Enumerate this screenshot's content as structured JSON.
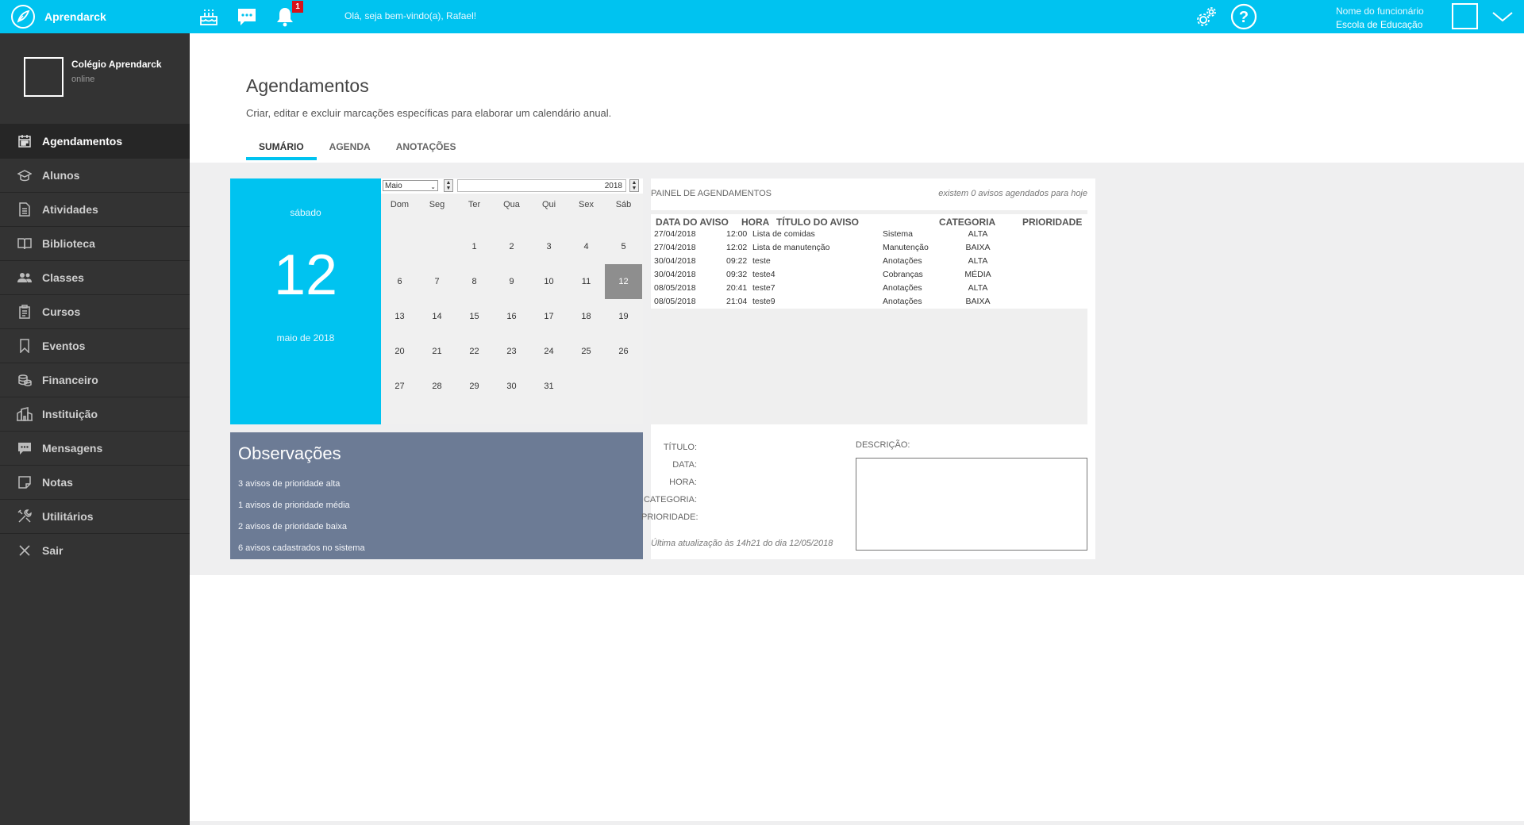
{
  "topbar": {
    "app_name": "Aprendarck",
    "notification_count": "1",
    "welcome": "Olá, seja bem-vindo(a), Rafael!",
    "user_name": "Nome do funcionário",
    "user_school": "Escola de Educação",
    "icons": [
      "logo-icon",
      "cake-icon",
      "chat-icon",
      "bell-icon",
      "gears-icon",
      "help-icon",
      "chevron-down-icon"
    ],
    "bg_color": "#00c3f0"
  },
  "sidebar": {
    "school_name": "Colégio Aprendarck",
    "status": "online",
    "items": [
      {
        "label": "Agendamentos",
        "icon": "calendar-icon"
      },
      {
        "label": "Alunos",
        "icon": "graduation-cap-icon"
      },
      {
        "label": "Atividades",
        "icon": "document-icon"
      },
      {
        "label": "Biblioteca",
        "icon": "book-icon"
      },
      {
        "label": "Classes",
        "icon": "users-icon"
      },
      {
        "label": "Cursos",
        "icon": "clipboard-icon"
      },
      {
        "label": "Eventos",
        "icon": "bookmark-icon"
      },
      {
        "label": "Financeiro",
        "icon": "coins-icon"
      },
      {
        "label": "Instituição",
        "icon": "building-icon"
      },
      {
        "label": "Mensagens",
        "icon": "message-icon"
      },
      {
        "label": "Notas",
        "icon": "note-icon"
      },
      {
        "label": "Utilitários",
        "icon": "tools-icon"
      },
      {
        "label": "Sair",
        "icon": "close-icon"
      }
    ]
  },
  "main": {
    "title": "Agendamentos",
    "description": "Criar, editar e excluir marcações específicas para elaborar um calendário anual.",
    "tabs": [
      {
        "label": "SUMÁRIO"
      },
      {
        "label": "AGENDA"
      },
      {
        "label": "ANOTAÇÕES"
      }
    ]
  },
  "date_panel": {
    "weekday": "sábado",
    "day": "12",
    "month_year": "maio de 2018"
  },
  "calendar": {
    "month": "Maio",
    "year": "2018",
    "weekdays": [
      "Dom",
      "Seg",
      "Ter",
      "Qua",
      "Qui",
      "Sex",
      "Sáb"
    ],
    "weeks": [
      [
        "",
        "",
        "1",
        "2",
        "3",
        "4",
        "5"
      ],
      [
        "6",
        "7",
        "8",
        "9",
        "10",
        "11",
        "12"
      ],
      [
        "13",
        "14",
        "15",
        "16",
        "17",
        "18",
        "19"
      ],
      [
        "20",
        "21",
        "22",
        "23",
        "24",
        "25",
        "26"
      ],
      [
        "27",
        "28",
        "29",
        "30",
        "31",
        "",
        ""
      ]
    ],
    "selected": "12"
  },
  "observations": {
    "title": "Observações",
    "lines": [
      "3 avisos de prioridade alta",
      "1 avisos de prioridade média",
      "2 avisos de prioridade baixa",
      "6 avisos cadastrados no sistema"
    ]
  },
  "schedule_panel": {
    "title": "PAINEL DE AGENDAMENTOS",
    "today_count": "existem 0 avisos agendados para hoje",
    "columns": [
      "DATA DO AVISO",
      "HORA",
      "TÍTULO DO AVISO",
      "CATEGORIA",
      "PRIORIDADE"
    ],
    "rows": [
      [
        "27/04/2018",
        "12:00",
        "Lista de comidas",
        "Sistema",
        "ALTA"
      ],
      [
        "27/04/2018",
        "12:02",
        "Lista de manutenção",
        "Manutenção",
        "BAIXA"
      ],
      [
        "30/04/2018",
        "09:22",
        "teste",
        "Anotações",
        "ALTA"
      ],
      [
        "30/04/2018",
        "09:32",
        "teste4",
        "Cobranças",
        "MÉDIA"
      ],
      [
        "08/05/2018",
        "20:41",
        "teste7",
        "Anotações",
        "ALTA"
      ],
      [
        "08/05/2018",
        "21:04",
        "teste9",
        "Anotações",
        "BAIXA"
      ]
    ]
  },
  "details": {
    "labels": [
      "TÍTULO:",
      "DATA:",
      "HORA:",
      "CATEGORIA:",
      "PRIORIDADE:"
    ],
    "description_label": "DESCRIÇÃO:",
    "last_update": "Última atualização às 14h21 do dia 12/05/2018"
  }
}
